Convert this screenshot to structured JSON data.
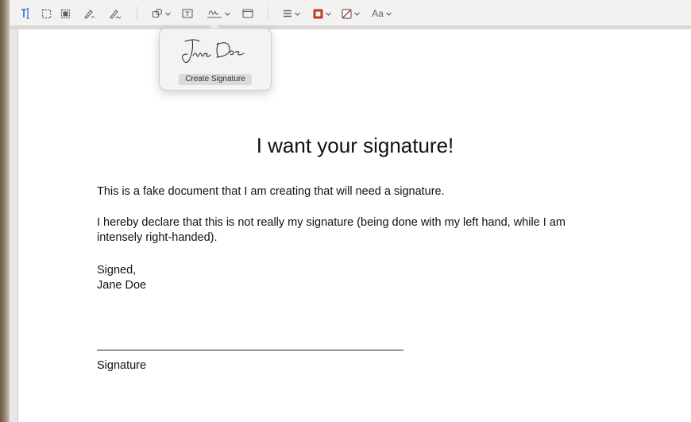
{
  "toolbar": {
    "items": [
      {
        "icon": "text-selection-icon"
      },
      {
        "icon": "rect-selection-icon"
      },
      {
        "icon": "redact-icon"
      },
      {
        "icon": "sketch-icon"
      },
      {
        "icon": "draw-icon"
      },
      {
        "icon": "shapes-icon"
      },
      {
        "icon": "text-box-icon"
      },
      {
        "icon": "sign-icon"
      },
      {
        "icon": "note-icon"
      },
      {
        "icon": "shape-style-icon"
      },
      {
        "icon": "border-color-icon"
      },
      {
        "icon": "fill-color-icon"
      },
      {
        "icon": "text-style-icon",
        "label": "Aa"
      }
    ],
    "accent": "#1e6fd9",
    "border_color": "#c0392b"
  },
  "popover": {
    "create_signature_label": "Create Signature"
  },
  "document": {
    "title": "I want your signature!",
    "para1": "This is a fake document that I am creating that will need a signature.",
    "para2": "I hereby declare that this is not really my signature (being done with my left hand, while I am intensely right-handed).",
    "signed_label": "Signed,",
    "signer_name": "Jane Doe",
    "signature_caption": "Signature"
  }
}
